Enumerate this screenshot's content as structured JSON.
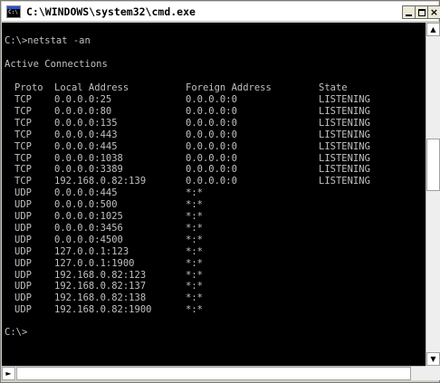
{
  "window": {
    "title": "C:\\WINDOWS\\system32\\cmd.exe",
    "icon_text": "C:\\",
    "min_glyph": "minimize-icon",
    "max_glyph": "maximize-icon",
    "close_glyph": "×"
  },
  "console": {
    "prompt_command": "C:\\>netstat -an",
    "section_title": "Active Connections",
    "headers": {
      "proto": "Proto",
      "local": "Local Address",
      "foreign": "Foreign Address",
      "state": "State"
    },
    "rows": [
      {
        "proto": "TCP",
        "local": "0.0.0.0:25",
        "foreign": "0.0.0.0:0",
        "state": "LISTENING"
      },
      {
        "proto": "TCP",
        "local": "0.0.0.0:80",
        "foreign": "0.0.0.0:0",
        "state": "LISTENING"
      },
      {
        "proto": "TCP",
        "local": "0.0.0.0:135",
        "foreign": "0.0.0.0:0",
        "state": "LISTENING"
      },
      {
        "proto": "TCP",
        "local": "0.0.0.0:443",
        "foreign": "0.0.0.0:0",
        "state": "LISTENING"
      },
      {
        "proto": "TCP",
        "local": "0.0.0.0:445",
        "foreign": "0.0.0.0:0",
        "state": "LISTENING"
      },
      {
        "proto": "TCP",
        "local": "0.0.0.0:1038",
        "foreign": "0.0.0.0:0",
        "state": "LISTENING"
      },
      {
        "proto": "TCP",
        "local": "0.0.0.0:3389",
        "foreign": "0.0.0.0:0",
        "state": "LISTENING"
      },
      {
        "proto": "TCP",
        "local": "192.168.0.82:139",
        "foreign": "0.0.0.0:0",
        "state": "LISTENING"
      },
      {
        "proto": "UDP",
        "local": "0.0.0.0:445",
        "foreign": "*:*",
        "state": ""
      },
      {
        "proto": "UDP",
        "local": "0.0.0.0:500",
        "foreign": "*:*",
        "state": ""
      },
      {
        "proto": "UDP",
        "local": "0.0.0.0:1025",
        "foreign": "*:*",
        "state": ""
      },
      {
        "proto": "UDP",
        "local": "0.0.0.0:3456",
        "foreign": "*:*",
        "state": ""
      },
      {
        "proto": "UDP",
        "local": "0.0.0.0:4500",
        "foreign": "*:*",
        "state": ""
      },
      {
        "proto": "UDP",
        "local": "127.0.0.1:123",
        "foreign": "*:*",
        "state": ""
      },
      {
        "proto": "UDP",
        "local": "127.0.0.1:1900",
        "foreign": "*:*",
        "state": ""
      },
      {
        "proto": "UDP",
        "local": "192.168.0.82:123",
        "foreign": "*:*",
        "state": ""
      },
      {
        "proto": "UDP",
        "local": "192.168.0.82:137",
        "foreign": "*:*",
        "state": ""
      },
      {
        "proto": "UDP",
        "local": "192.168.0.82:138",
        "foreign": "*:*",
        "state": ""
      },
      {
        "proto": "UDP",
        "local": "192.168.0.82:1900",
        "foreign": "*:*",
        "state": ""
      }
    ],
    "final_prompt": "C:\\>"
  },
  "scrollbars": {
    "up_arrow": "▲",
    "down_arrow": "▼",
    "left_arrow": "◄",
    "right_arrow": "►"
  },
  "colors": {
    "console_bg": "#000000",
    "console_text": "#c0c0c0"
  }
}
